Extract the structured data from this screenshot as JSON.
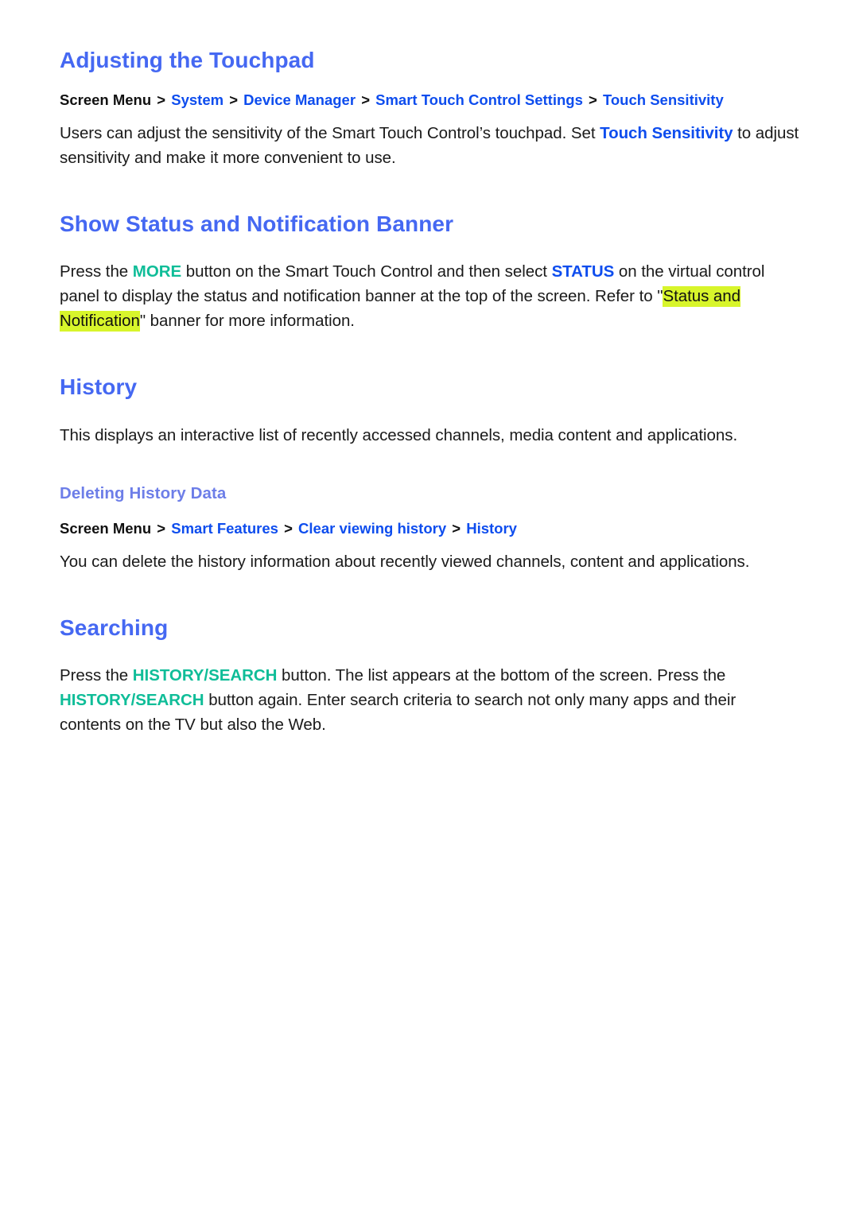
{
  "document": {
    "page_background": "#ffffff",
    "accent_heading_color": "#4568f2",
    "accent_subheading_color": "#6d7ee8",
    "link_color": "#0e4dee",
    "keyword_teal_color": "#0fbd98",
    "highlight_color": "#d8f52b",
    "body_text_color": "#1a1a1a"
  },
  "sections": {
    "adjusting_touchpad": {
      "title": "Adjusting the Touchpad",
      "breadcrumb": {
        "root": "Screen Menu",
        "sep": ">",
        "links": [
          "System",
          "Device Manager",
          "Smart Touch Control Settings",
          "Touch Sensitivity"
        ]
      },
      "body": {
        "part1": "Users can adjust the sensitivity of the Smart Touch Control’s touchpad. Set ",
        "link1": "Touch Sensitivity",
        "part2": " to adjust sensitivity and make it more convenient to use."
      }
    },
    "status_banner": {
      "title": "Show Status and Notification Banner",
      "body": {
        "part1": "Press the ",
        "kw1": "MORE",
        "part2": " button on the Smart Touch Control and then select ",
        "kw2": "STATUS",
        "part3": " on the virtual control panel to display the status and notification banner at the top of the screen. Refer to \"",
        "highlight": "Status and Notification",
        "part4": "\" banner for more information."
      }
    },
    "history": {
      "title": "History",
      "body": "This displays an interactive list of recently accessed channels, media content and applications.",
      "subsection": {
        "title": "Deleting History Data",
        "breadcrumb": {
          "root": "Screen Menu",
          "sep": ">",
          "links": [
            "Smart Features",
            "Clear viewing history",
            "History"
          ]
        },
        "body": "You can delete the history information about recently viewed channels, content and applications."
      }
    },
    "searching": {
      "title": "Searching",
      "body": {
        "part1": "Press the ",
        "kw1": "HISTORY/SEARCH",
        "part2": " button. The list appears at the bottom of the screen. Press the ",
        "kw2": "HISTORY/SEARCH",
        "part3": " button again. Enter search criteria to search not only many apps and their contents on the TV but also the Web."
      }
    }
  }
}
